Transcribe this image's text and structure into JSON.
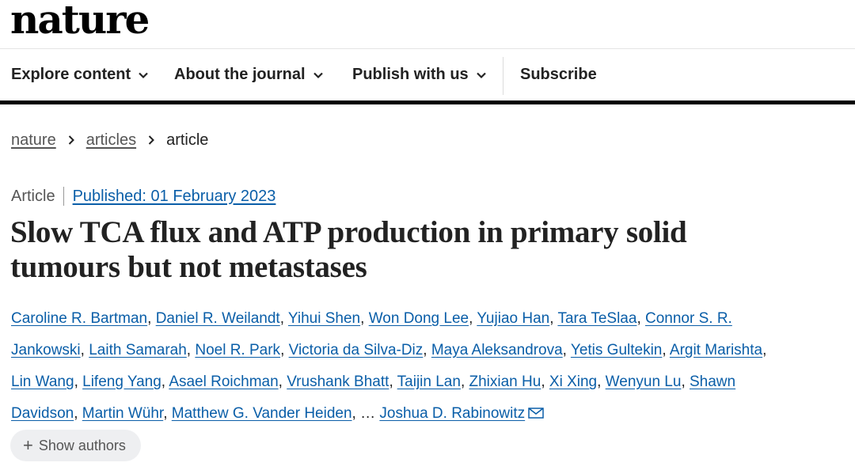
{
  "header": {
    "logo": "nature"
  },
  "nav": {
    "items": [
      {
        "label": "Explore content",
        "dropdown": true
      },
      {
        "label": "About the journal",
        "dropdown": true
      },
      {
        "label": "Publish with us",
        "dropdown": true
      },
      {
        "label": "Subscribe",
        "dropdown": false
      }
    ]
  },
  "breadcrumb": {
    "items": [
      "nature",
      "articles"
    ],
    "current": "article",
    "separator_icon": "chevron-right-icon"
  },
  "article": {
    "type": "Article",
    "published": "Published: 01 February 2023",
    "title": "Slow TCA flux and ATP production in primary solid tumours but not metastases",
    "authors": [
      "Caroline R. Bartman",
      "Daniel R. Weilandt",
      "Yihui Shen",
      "Won Dong Lee",
      "Yujiao Han",
      "Tara TeSlaa",
      "Connor S. R. Jankowski",
      "Laith Samarah",
      "Noel R. Park",
      "Victoria da Silva-Diz",
      "Maya Aleksandrova",
      "Yetis Gultekin",
      "Argit Marishta",
      "Lin Wang",
      "Lifeng Yang",
      "Asael Roichman",
      "Vrushank Bhatt",
      "Taijin Lan",
      "Zhixian Hu",
      "Xi Xing",
      "Wenyun Lu",
      "Shawn Davidson",
      "Martin Wühr",
      "Matthew G. Vander Heiden"
    ],
    "ellipsis": "…",
    "corresponding_author": "Joshua D. Rabinowitz",
    "mail_icon": "mail-icon",
    "show_authors_label": "Show authors",
    "show_authors_icon": "plus-icon"
  },
  "colors": {
    "link": "#0a5ea8",
    "text": "#222222",
    "muted": "#555555",
    "pill_bg": "#eeeff1"
  }
}
